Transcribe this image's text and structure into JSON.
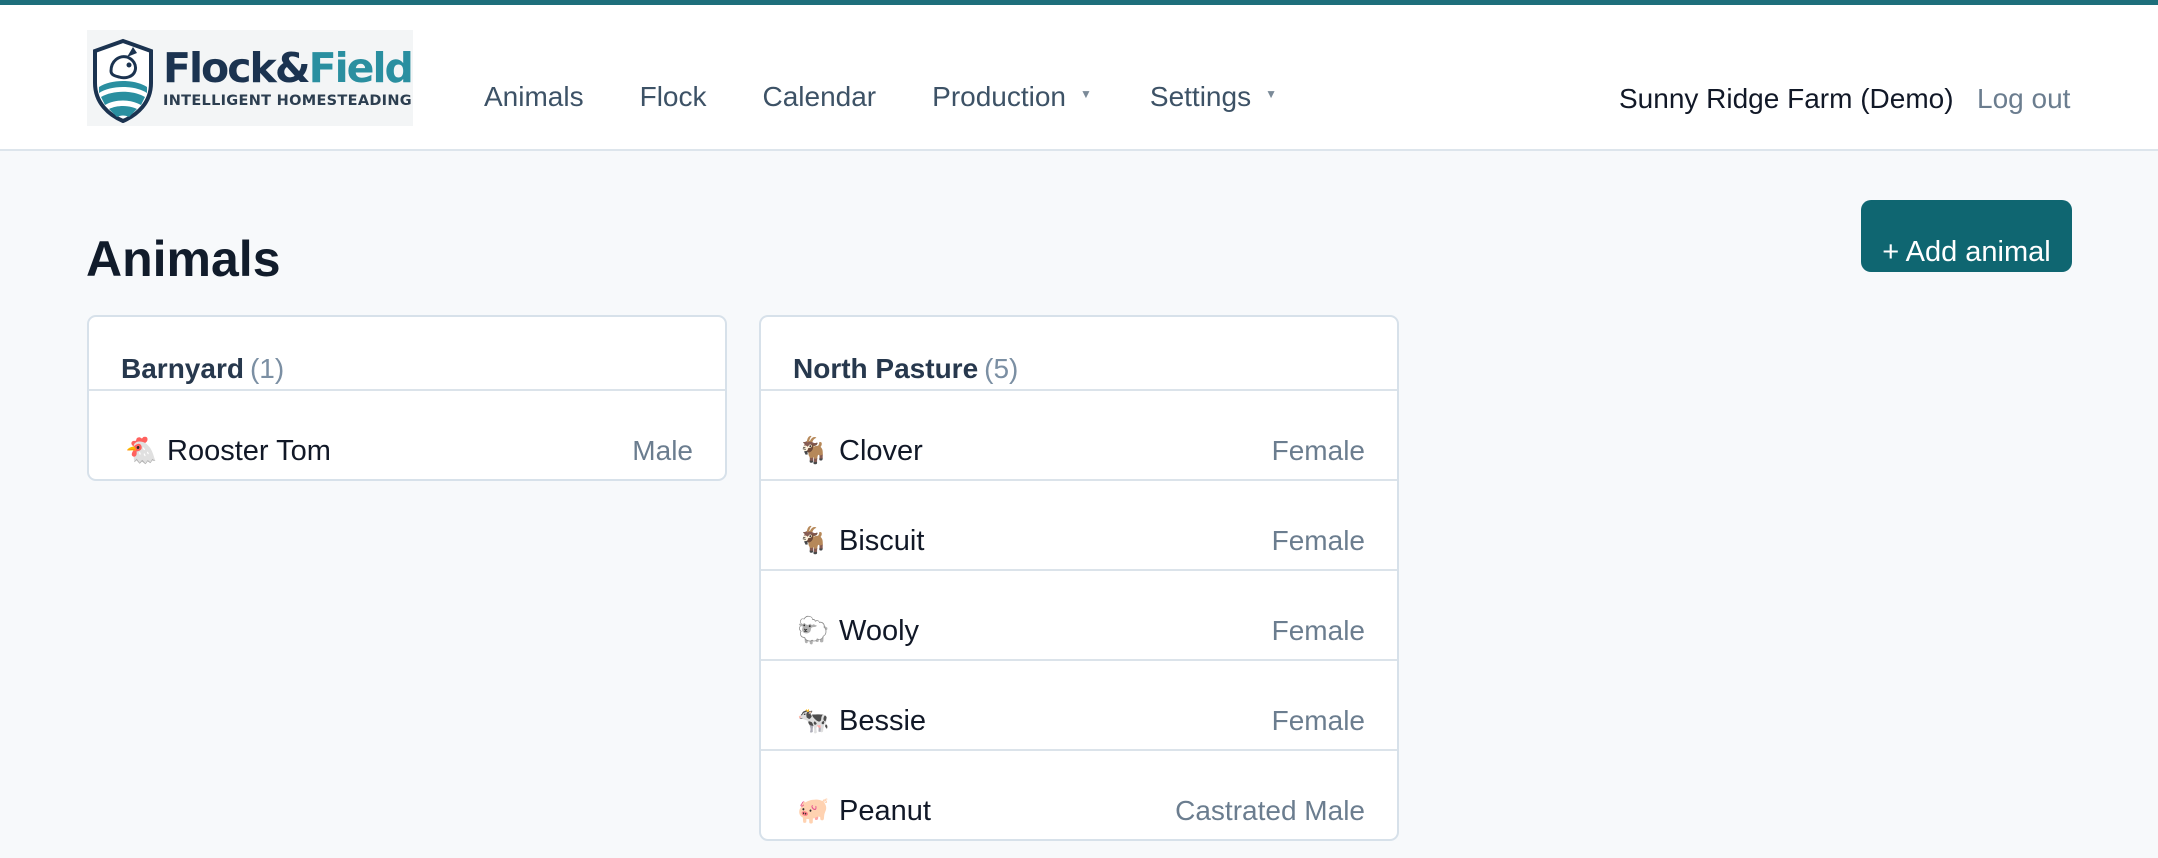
{
  "header": {
    "logo": {
      "word_part1": "Flock",
      "amp": "&",
      "word_part2": "Field",
      "tagline": "INTELLIGENT HOMESTEADING"
    },
    "nav": [
      {
        "label": "Animals",
        "dropdown": false
      },
      {
        "label": "Flock",
        "dropdown": false
      },
      {
        "label": "Calendar",
        "dropdown": false
      },
      {
        "label": "Production",
        "dropdown": true
      },
      {
        "label": "Settings",
        "dropdown": true
      }
    ],
    "farm_name": "Sunny Ridge Farm (Demo)",
    "logout_label": "Log out"
  },
  "page": {
    "title": "Animals",
    "add_button_label": "+ Add animal"
  },
  "colors": {
    "accent": "#0f6671",
    "topbar": "#1e6f7b",
    "logo_dark": "#1b3350",
    "logo_teal": "#2a8fa0"
  },
  "groups": [
    {
      "name": "Barnyard",
      "count": "(1)",
      "animals": [
        {
          "icon": "🐔",
          "icon_name": "chicken-icon",
          "name": "Rooster Tom",
          "sex": "Male"
        }
      ]
    },
    {
      "name": "North Pasture",
      "count": "(5)",
      "animals": [
        {
          "icon": "🐐",
          "icon_name": "goat-icon",
          "name": "Clover",
          "sex": "Female"
        },
        {
          "icon": "🐐",
          "icon_name": "goat-icon",
          "name": "Biscuit",
          "sex": "Female"
        },
        {
          "icon": "🐑",
          "icon_name": "sheep-icon",
          "name": "Wooly",
          "sex": "Female"
        },
        {
          "icon": "🐄",
          "icon_name": "cow-icon",
          "name": "Bessie",
          "sex": "Female"
        },
        {
          "icon": "🐖",
          "icon_name": "pig-icon",
          "name": "Peanut",
          "sex": "Castrated Male"
        }
      ]
    }
  ]
}
